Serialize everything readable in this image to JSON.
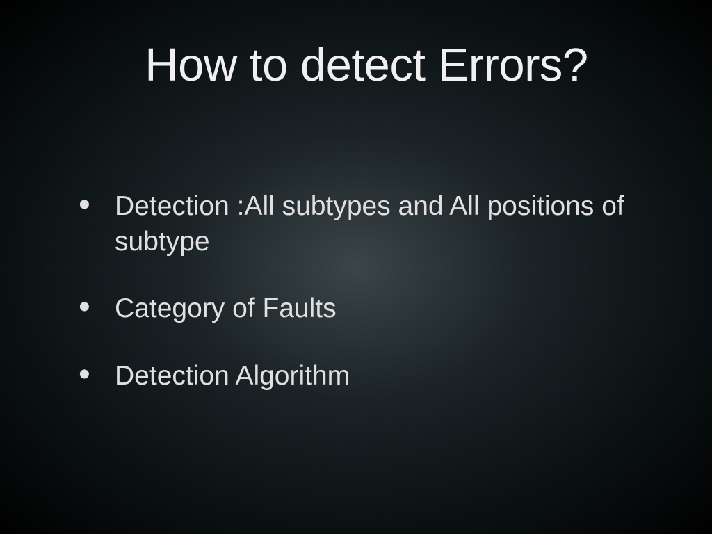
{
  "slide": {
    "title": "How to detect Errors?",
    "bullets": [
      "Detection :All subtypes and All positions of subtype",
      "Category of Faults",
      "Detection Algorithm"
    ]
  }
}
